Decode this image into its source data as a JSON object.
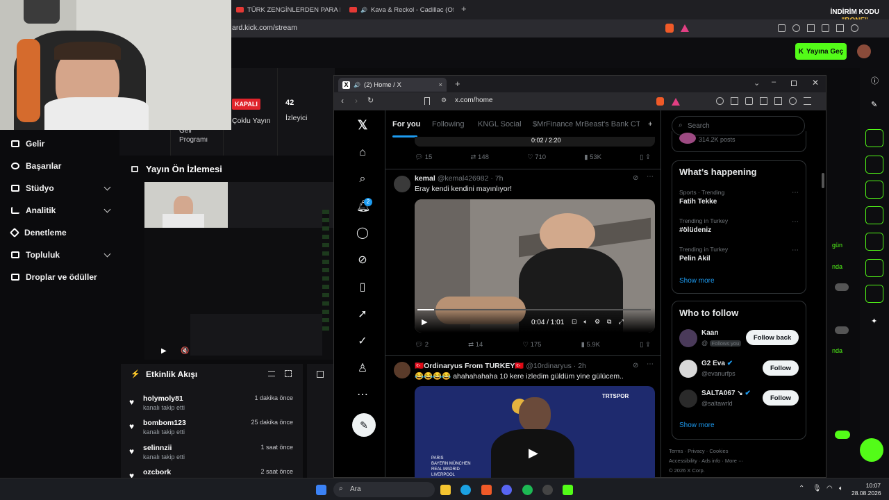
{
  "outer_browser": {
    "tabs": [
      "TÜRK ZENGİNLERDEN PARA DİLENEN",
      "Kava & Reckol - Cadillac (Official"
    ],
    "url": "ard.kick.com/stream",
    "promo_line1": "İNDİRİM KODU",
    "promo_code": "\"BONE\""
  },
  "kick": {
    "go_live": "Yayına Geç",
    "nav": [
      "Gelir",
      "Başarılar",
      "Stüdyo",
      "Analitik",
      "Denetleme",
      "Topluluk",
      "Droplar ve ödüller"
    ],
    "status_badge": "KAPALI",
    "stream_type": "Çoklu Yayın",
    "viewers_count": "42",
    "viewers_label": "İzleyici",
    "income_label": "Geli\nProgramı",
    "preview_title": "Yayın Ön İzlemesi",
    "activity_title": "Etkinlik Akışı",
    "activity": [
      {
        "name": "holymoly81",
        "sub": "kanalı takip etti",
        "time": "1 dakika önce"
      },
      {
        "name": "bombom123",
        "sub": "kanalı takip etti",
        "time": "25 dakika önce"
      },
      {
        "name": "selinnzii",
        "sub": "kanalı takip etti",
        "time": "1 saat önce"
      },
      {
        "name": "ozcbork",
        "sub": "",
        "time": "2 saat önce"
      }
    ],
    "right_labels": [
      "gün",
      "nda",
      "nda"
    ]
  },
  "x_browser": {
    "tab_title": "(2) Home / X",
    "url": "x.com/home",
    "feed_tabs": [
      "For you",
      "Following",
      "KNGL Social",
      "$MrFinance MrBeast's Bank CTO"
    ],
    "notification_count": "2",
    "top_actions": {
      "replies": "15",
      "reposts": "148",
      "likes": "710",
      "views": "53K"
    },
    "top_video_time": "0:02 / 2:20",
    "tweets": [
      {
        "name": "kemal",
        "handle": "@kemal426982 · 7h",
        "text": "Eray kendi kendini mayınlıyor!",
        "video_time": "0:04 / 1:01",
        "replies": "2",
        "reposts": "14",
        "likes": "175",
        "views": "5.9K"
      },
      {
        "name": "🇹🇷Ordinaryus From TURKEY🇹🇷",
        "handle": "@10rdinaryus · 2h",
        "text": "😂😂😂😂 ahahahahaha 10 kere izledim güldüm yine gülücem..",
        "overlay_list": [
          "PARIS",
          "BAYERN MÜNCHEN",
          "REAL MADRID",
          "LIVERPOOL"
        ],
        "tv_logo": "TRTSPOR"
      }
    ],
    "search_placeholder": "Search",
    "top_card_text": "314.2K posts",
    "whats_happening": {
      "title": "What’s happening",
      "trends": [
        {
          "sub": "Sports · Trending",
          "name": "Fatih Tekke"
        },
        {
          "sub": "Trending in Turkey",
          "name": "#ölüdeniz"
        },
        {
          "sub": "Trending in Turkey",
          "name": "Pelin Akil"
        }
      ],
      "show_more": "Show more"
    },
    "who_to_follow": {
      "title": "Who to follow",
      "users": [
        {
          "name": "Kaan",
          "handle": "@",
          "badge": "Follows you",
          "button": "Follow back"
        },
        {
          "name": "G2 Eva",
          "handle": "@evanurfps",
          "badge": "",
          "button": "Follow"
        },
        {
          "name": "SALTA067 ↘",
          "handle": "@saltawrld",
          "badge": "",
          "button": "Follow"
        }
      ],
      "show_more": "Show more"
    },
    "footer": [
      "Terms",
      "Privacy",
      "Cookies",
      "Accessibility",
      "Ads info",
      "More ···",
      "© 2026 X Corp."
    ]
  },
  "taskbar": {
    "search": "Ara",
    "time": "10:07",
    "date": "28.08.2026"
  },
  "colors": {
    "kick_green": "#53fc18",
    "x_blue": "#1d9bf0",
    "badge_red": "#e0242b"
  }
}
